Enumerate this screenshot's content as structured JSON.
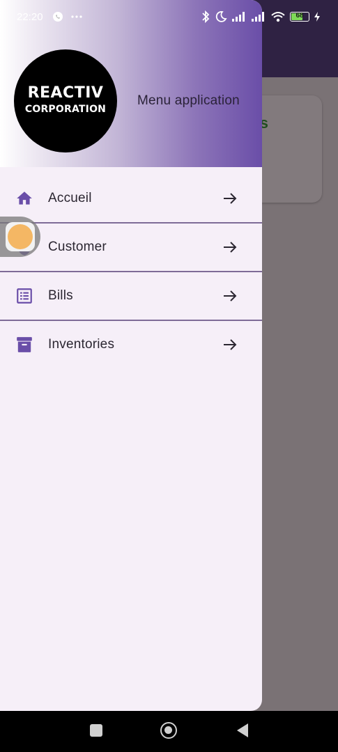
{
  "status_bar": {
    "time": "22:20",
    "battery_level": "68",
    "left_icons": [
      "whatsapp-icon",
      "more-dots-icon"
    ],
    "right_icons": [
      "bluetooth-icon",
      "moon-icon",
      "signal-icon",
      "signal-icon",
      "wifi-icon",
      "battery-icon",
      "charging-icon"
    ]
  },
  "background_app": {
    "card_text": "res"
  },
  "drawer": {
    "logo": {
      "line1": "REACTIV",
      "line2": "CORPORATION"
    },
    "header_title": "Menu application",
    "items": [
      {
        "label": "Accueil",
        "icon": "home-icon"
      },
      {
        "label": "Customer",
        "icon": "verified-user-icon"
      },
      {
        "label": "Bills",
        "icon": "list-icon"
      },
      {
        "label": "Inventories",
        "icon": "archive-icon"
      }
    ]
  },
  "colors": {
    "accent": "#6a4ea8",
    "drawer_background": "#f6eff8",
    "divider": "#7e6b97",
    "scrim": "#786f72"
  }
}
